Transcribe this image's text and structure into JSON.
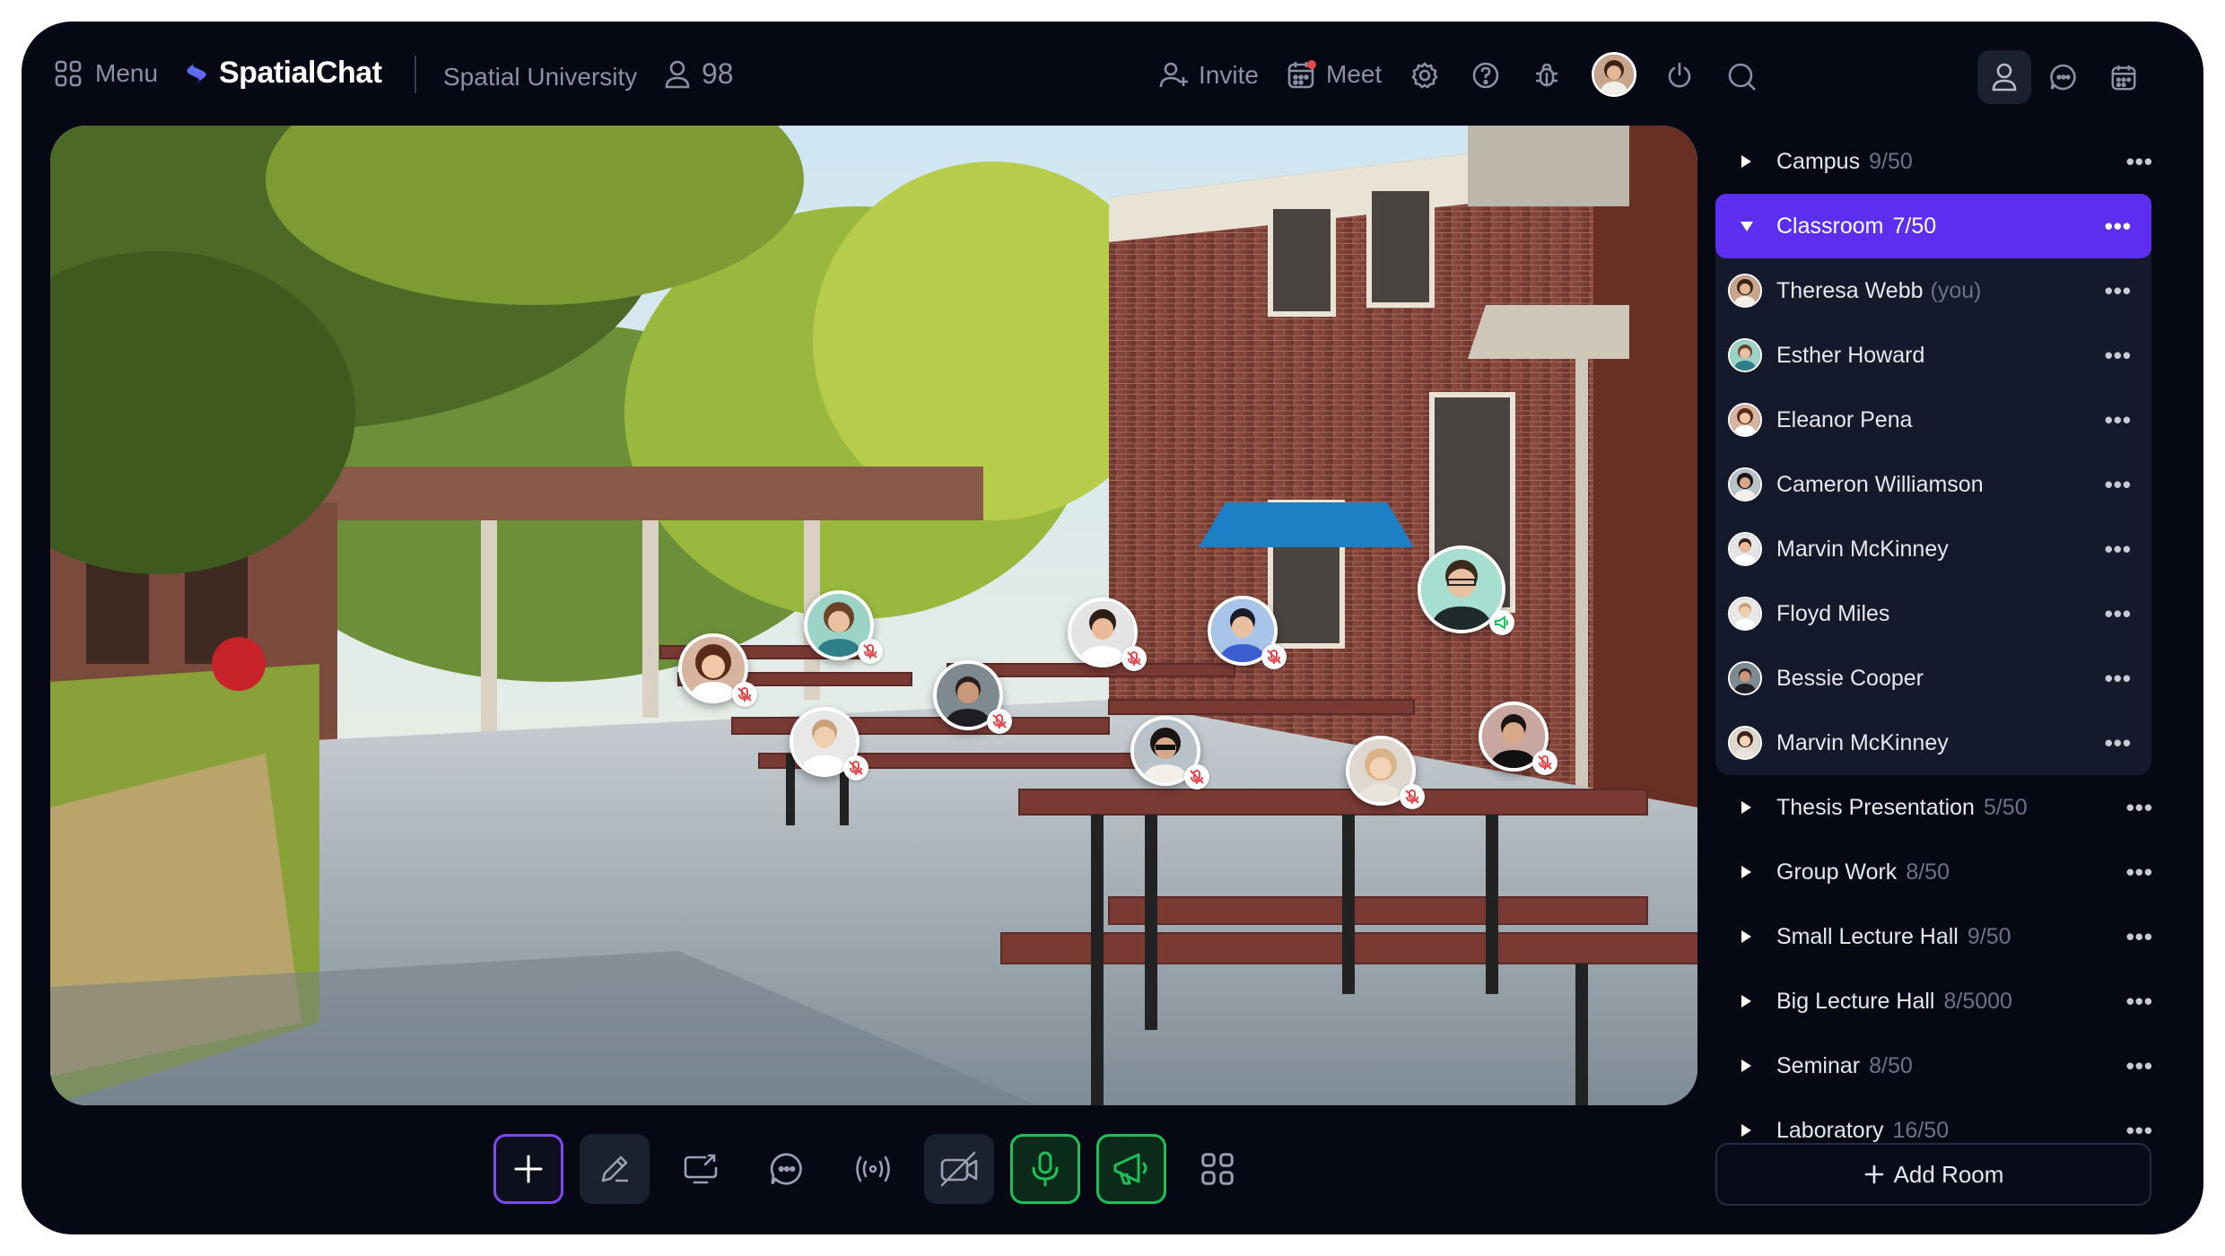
{
  "topbar": {
    "menu_label": "Menu",
    "brand_name": "SpatialChat",
    "space_name": "Spatial University",
    "participant_count": "98",
    "invite_label": "Invite",
    "meet_label": "Meet"
  },
  "sidebar": {
    "rooms_top": [
      {
        "name": "Campus",
        "count": "9/50"
      }
    ],
    "selected_room": {
      "name": "Classroom",
      "count": "7/50"
    },
    "members": [
      {
        "name": "Theresa Webb",
        "suffix": "(you)"
      },
      {
        "name": "Esther Howard",
        "suffix": ""
      },
      {
        "name": "Eleanor Pena",
        "suffix": ""
      },
      {
        "name": "Cameron Williamson",
        "suffix": ""
      },
      {
        "name": "Marvin McKinney",
        "suffix": ""
      },
      {
        "name": "Floyd Miles",
        "suffix": ""
      },
      {
        "name": "Bessie Cooper",
        "suffix": ""
      },
      {
        "name": "Marvin McKinney",
        "suffix": ""
      }
    ],
    "rooms_bottom": [
      {
        "name": "Thesis Presentation",
        "count": "5/50"
      },
      {
        "name": "Group Work",
        "count": "8/50"
      },
      {
        "name": "Small Lecture Hall",
        "count": "9/50"
      },
      {
        "name": "Big Lecture Hall",
        "count": "8/5000"
      },
      {
        "name": "Seminar",
        "count": "8/50"
      },
      {
        "name": "Laboratory",
        "count": "16/50"
      }
    ],
    "more_glyph": "•••",
    "add_room_label": "Add Room"
  },
  "colors": {
    "background": "#060914",
    "accent_purple": "#5b2ef0",
    "accent_green": "#1fbf5a",
    "mute_red": "#e5484d"
  }
}
